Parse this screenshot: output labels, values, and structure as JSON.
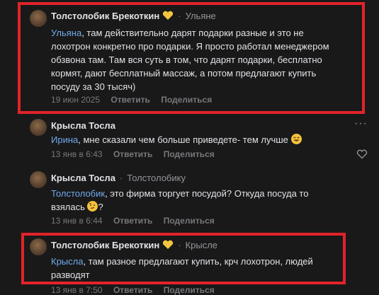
{
  "comments": [
    {
      "author": "Толстолобик Брекоткин",
      "reply_to": "Ульяне",
      "mention": "Ульяна",
      "text_1": ", там действительно дарят подарки разные и это не",
      "text_2": "лохотрон конкретно про подарки. Я просто работал менеджером",
      "text_3": "обзвона там. Там вся суть в том, что дарят подарки, бесплатно",
      "text_4": "кормят, дают бесплатный массаж, а потом предлагают купить",
      "text_5": "посуду за 30 тысяч)",
      "date": "19 июн 2025",
      "reply_label": "Ответить",
      "share_label": "Поделиться"
    },
    {
      "author": "Крысла Тосла",
      "mention": "Ирина",
      "text_1": ", мне сказали чем больше приведете- тем лучше",
      "date": "13 янв в 6:43",
      "reply_label": "Ответить",
      "share_label": "Поделиться"
    },
    {
      "author": "Крысла Тосла",
      "reply_to": "Толстолобику",
      "mention": "Толстолобик",
      "text_1": ", это фирма торгует посудой? Откуда посуда то",
      "text_2": "взялась",
      "date": "13 янв в 6:44",
      "reply_label": "Ответить",
      "share_label": "Поделиться"
    },
    {
      "author": "Толстолобик Брекоткин",
      "reply_to": "Крысле",
      "mention": "Крысла",
      "text_1": ", там разное предлагают купить, крч лохотрон, людей",
      "text_2": "разводят",
      "date": "13 янв в 7:50",
      "reply_label": "Ответить",
      "share_label": "Поделиться"
    }
  ],
  "colors": {
    "background": "#19191a",
    "mention": "#71aaeb",
    "highlight": "#e2232a",
    "meta": "#76787a"
  }
}
